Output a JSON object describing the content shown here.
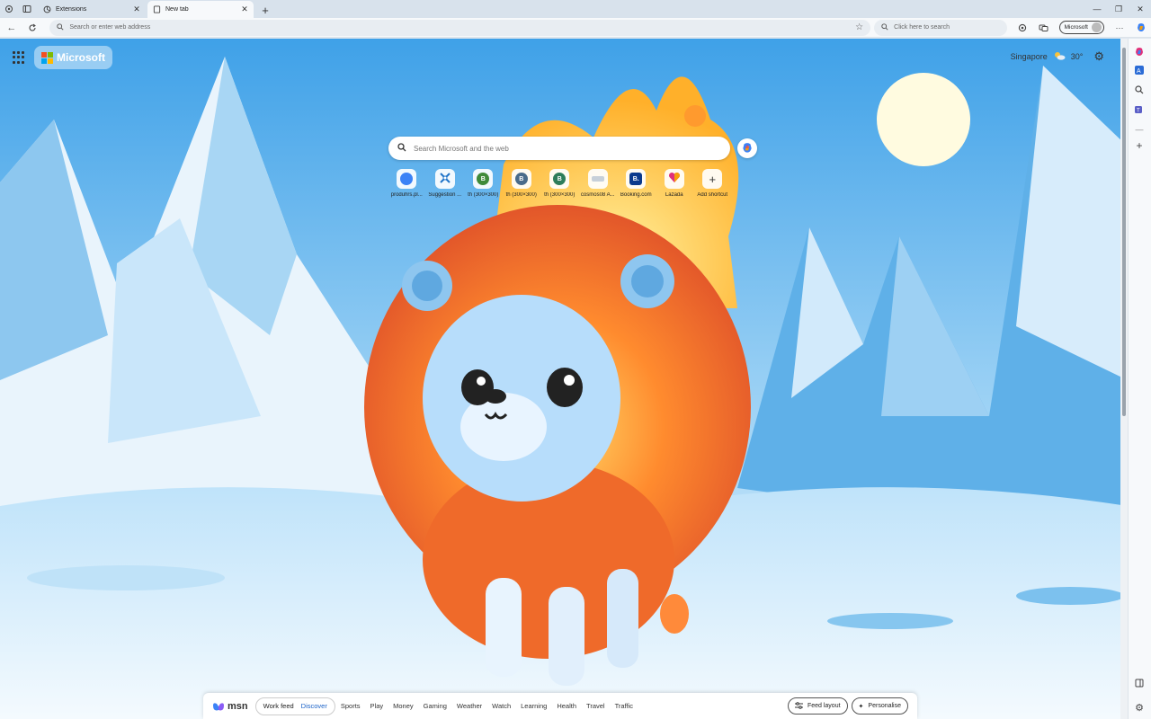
{
  "tabs": [
    {
      "title": "Extensions",
      "active": false
    },
    {
      "title": "New tab",
      "active": true
    }
  ],
  "toolbar": {
    "address_placeholder": "Search or enter web address",
    "search_placeholder": "Click here to search",
    "profile_label": "Microsoft"
  },
  "newtab": {
    "brand": "Microsoft",
    "location": "Singapore",
    "temperature": "30°",
    "search_placeholder": "Search Microsoft and the web",
    "shortcuts": [
      {
        "label": "produhrs.pl...",
        "glyph": "",
        "color": "#3b82f6"
      },
      {
        "label": "Suggestion ...",
        "glyph": "",
        "color": "#1e73c8"
      },
      {
        "label": "th (300×300)",
        "glyph": "B",
        "color": "#3f8a3a"
      },
      {
        "label": "th (300×300)",
        "glyph": "B",
        "color": "#4a6b8a"
      },
      {
        "label": "th (300×300)",
        "glyph": "B",
        "color": "#2e7d5b"
      },
      {
        "label": "cosmos08 A...",
        "glyph": "",
        "color": "#9aa6b2"
      },
      {
        "label": "Booking.com",
        "glyph": "B.",
        "color": "#0b3a8c"
      },
      {
        "label": "Lazada",
        "glyph": "",
        "color": "#e0307a"
      },
      {
        "label": "Add shortcut",
        "glyph": "+",
        "color": "#ffffff"
      }
    ]
  },
  "feed": {
    "brand": "msn",
    "tabs": [
      "Work feed",
      "Discover"
    ],
    "selected": "Discover",
    "categories": [
      "Sports",
      "Play",
      "Money",
      "Gaming",
      "Weather",
      "Watch",
      "Learning",
      "Health",
      "Travel",
      "Traffic"
    ],
    "feed_layout": "Feed layout",
    "personalise": "Personalise"
  }
}
